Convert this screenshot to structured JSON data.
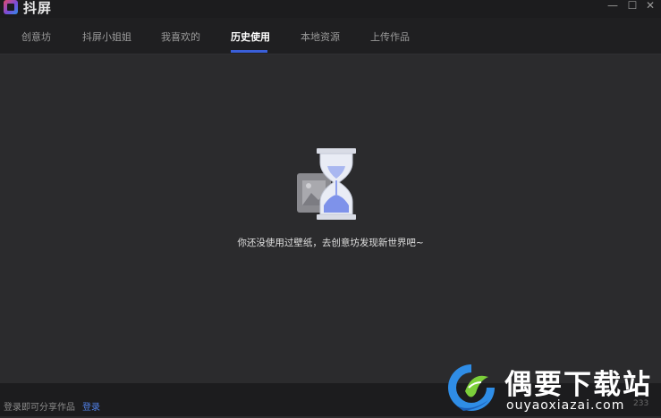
{
  "app": {
    "title": "抖屏"
  },
  "window_controls": {
    "minimize": "—",
    "maximize": "☐",
    "close": "✕"
  },
  "nav": {
    "tabs": [
      {
        "label": "创意坊"
      },
      {
        "label": "抖屏小姐姐"
      },
      {
        "label": "我喜欢的"
      },
      {
        "label": "历史使用"
      },
      {
        "label": "本地资源"
      },
      {
        "label": "上传作品"
      }
    ],
    "active_tab": "历史使用",
    "accent_color": "#3a5fd9"
  },
  "main": {
    "empty_state": {
      "icon": "hourglass-icon",
      "message": "你还没使用过壁纸，去创意坊发现新世界吧~"
    }
  },
  "footer": {
    "prompt": "登录即可分享作品",
    "login_link": "登录",
    "version": "233"
  },
  "watermark": {
    "title": "偶要下载站",
    "url": "ouyaoxiazai.com"
  }
}
